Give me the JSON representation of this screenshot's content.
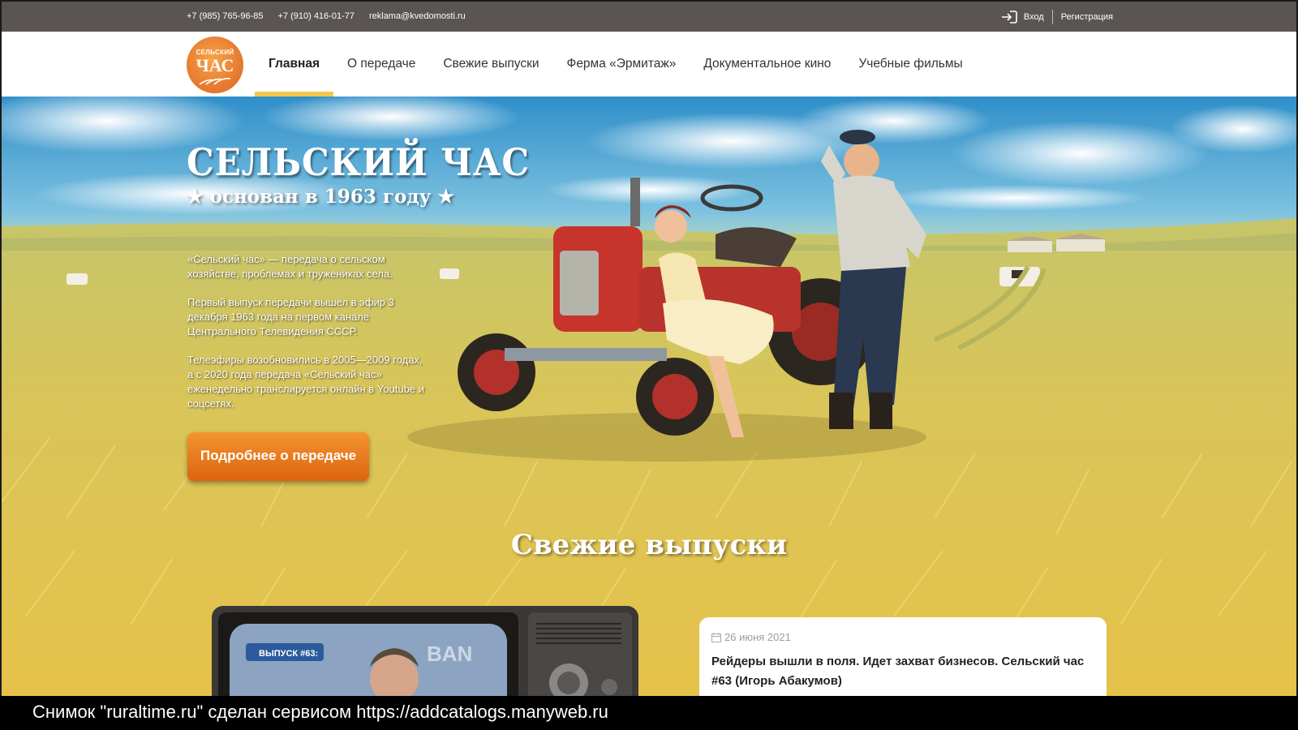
{
  "topbar": {
    "phone1": "+7 (985) 765-96-85",
    "phone2": "+7 (910) 416-01-77",
    "email": "reklama@kvedomosti.ru",
    "login": "Вход",
    "register": "Регистрация"
  },
  "logo": {
    "line1": "СЕЛЬСКИЙ",
    "line2": "ЧАС",
    "color": "#e8782c"
  },
  "nav": {
    "items": [
      {
        "label": "Главная",
        "active": true
      },
      {
        "label": "О передаче"
      },
      {
        "label": "Свежие выпуски"
      },
      {
        "label": "Ферма «Эрмитаж»"
      },
      {
        "label": "Документальное кино"
      },
      {
        "label": "Учебные фильмы"
      }
    ]
  },
  "hero": {
    "title": "СЕЛЬСКИЙ ЧАС",
    "subtitle": "★ основан в 1963 году ★",
    "paragraphs": [
      "«Сельский час» — передача о сельском хозяйстве, проблемах и тружениках села.",
      "Первый выпуск передачи вышел в эфир 3 декабря 1963 года на первом канале Центрального Телевидения СССР.",
      "Телеэфиры возобновились в 2005—2009 годах, а с 2020 года передача «Сельский час» еженедельно транслируется онлайн в Youtube и соцсетях."
    ],
    "button": "Подробнее о передаче",
    "button_color": "#e8781c"
  },
  "fresh": {
    "title": "Свежие выпуски",
    "tv_label": "ВЫПУСК #63:",
    "card": {
      "date": "26 июня 2021",
      "title": "Рейдеры вышли в поля. Идет захват бизнесов. Сельский час #63 (Игорь Абакумов)"
    }
  },
  "caption": "Снимок \"ruraltime.ru\" сделан сервисом https://addcatalogs.manyweb.ru"
}
